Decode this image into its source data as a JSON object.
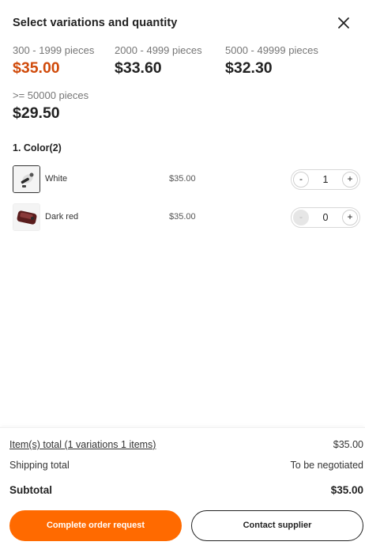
{
  "header": {
    "title": "Select variations and quantity",
    "close_icon": "close-icon"
  },
  "tiers": [
    {
      "qty": "300 - 1999 pieces",
      "price": "$35.00",
      "active": true
    },
    {
      "qty": "2000 - 4999 pieces",
      "price": "$33.60",
      "active": false
    },
    {
      "qty": "5000 - 49999 pieces",
      "price": "$32.30",
      "active": false
    },
    {
      "qty": ">= 50000 pieces",
      "price": "$29.50",
      "active": false
    }
  ],
  "colors": {
    "accent": "#ff6a00",
    "active_price": "#d04a0a"
  },
  "variations": {
    "section_label": "1. Color(2)",
    "items": [
      {
        "name": "White",
        "price": "$35.00",
        "quantity": "1",
        "minus": "-",
        "plus": "+",
        "selected": true,
        "minus_disabled": false
      },
      {
        "name": "Dark red",
        "price": "$35.00",
        "quantity": "0",
        "minus": "-",
        "plus": "+",
        "selected": false,
        "minus_disabled": true
      }
    ]
  },
  "summary": {
    "items_label": "Item(s) total (1 variations 1 items)",
    "items_value": "$35.00",
    "shipping_label": "Shipping total",
    "shipping_value": "To be negotiated",
    "subtotal_label": "Subtotal",
    "subtotal_value": "$35.00"
  },
  "actions": {
    "complete_label": "Complete order request",
    "contact_label": "Contact supplier"
  }
}
